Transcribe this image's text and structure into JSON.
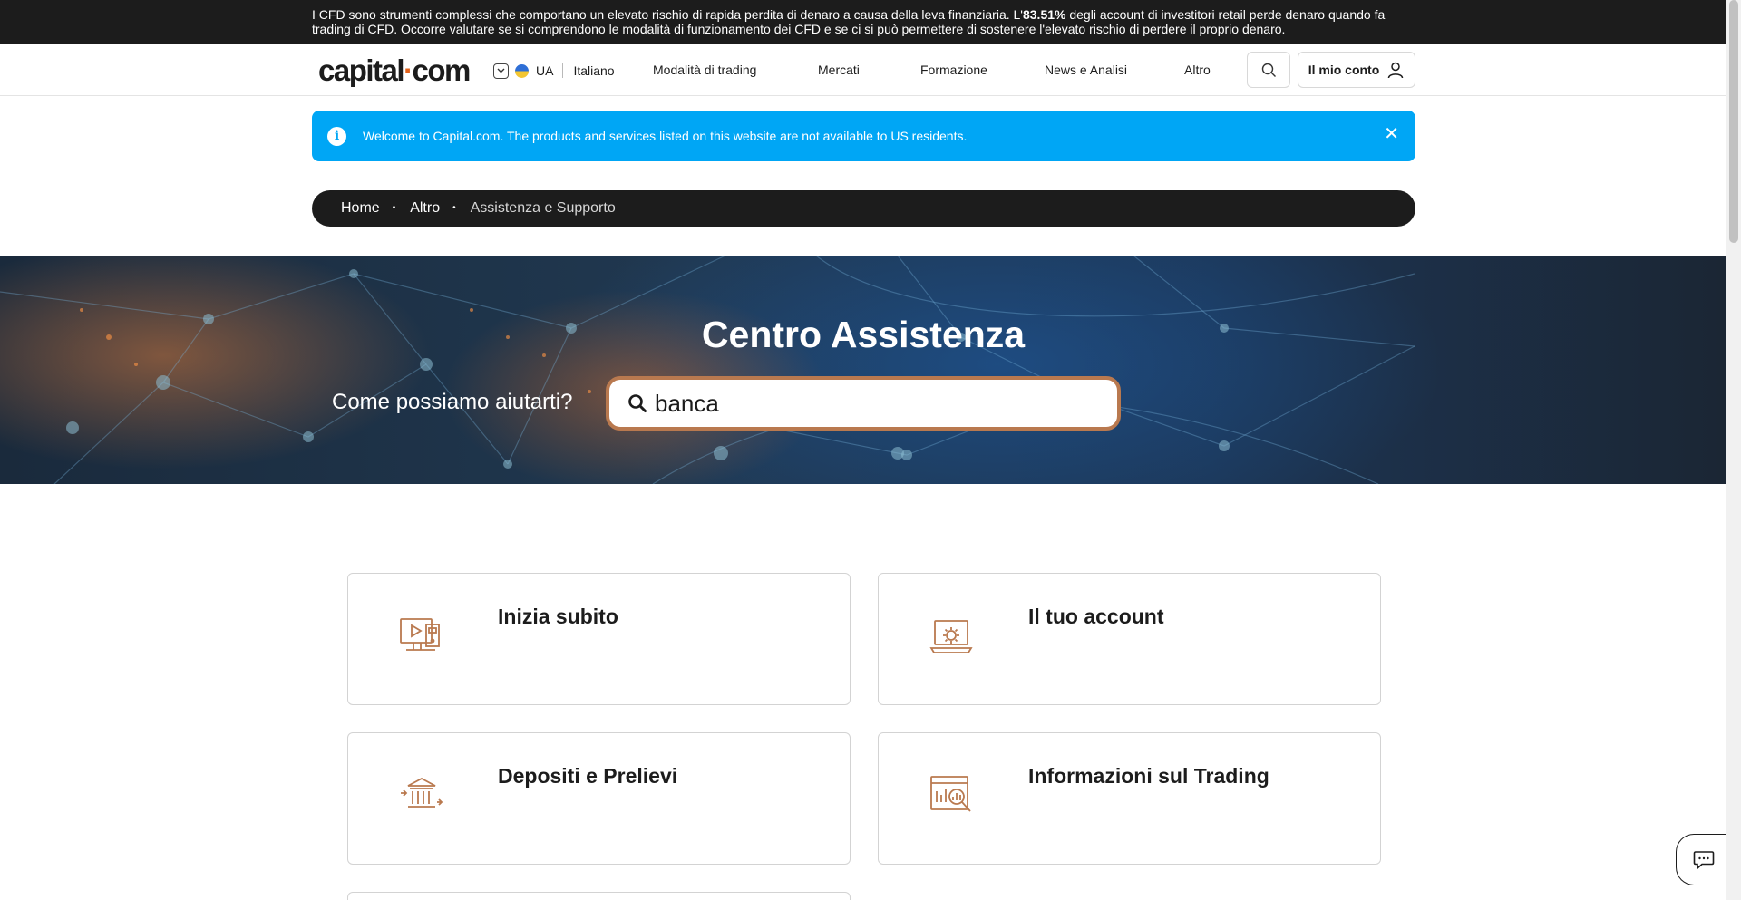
{
  "risk_warning": {
    "text_before": "I CFD sono strumenti complessi che comportano un elevato rischio di rapida perdita di denaro a causa della leva finanziaria. L'",
    "percent": "83.51%",
    "text_after": " degli account di investitori retail perde denaro quando fa trading di CFD. Occorre valutare se si comprendono le modalità di funzionamento dei CFD e se ci si può permettere di sostenere l'elevato rischio di perdere il proprio denaro."
  },
  "header": {
    "logo_left": "capital",
    "logo_dot": "·",
    "logo_right": "com",
    "region_code": "UA",
    "language": "Italiano",
    "nav": [
      "Modalità di trading",
      "Mercati",
      "Formazione",
      "News e Analisi",
      "Altro"
    ],
    "account_label": "Il mio conto"
  },
  "welcome_banner": {
    "message": "Welcome to Capital.com. The products and services listed on this website are not available to US residents.",
    "close_symbol": "✕",
    "info_symbol": "i"
  },
  "breadcrumb": {
    "items": [
      "Home",
      "Altro"
    ],
    "current": "Assistenza e Supporto",
    "separator": "•"
  },
  "hero": {
    "title": "Centro Assistenza",
    "search_label": "Come possiamo aiutarti?",
    "search_value": "banca"
  },
  "cards": [
    {
      "title": "Inizia subito",
      "icon": "video-screen-icon"
    },
    {
      "title": "Il tuo account",
      "icon": "laptop-gear-icon"
    },
    {
      "title": "Depositi e Prelievi",
      "icon": "bank-transfer-icon"
    },
    {
      "title": "Informazioni sul Trading",
      "icon": "chart-analysis-icon"
    }
  ],
  "colors": {
    "accent_orange": "#e2621b",
    "icon_brown": "#b9794f",
    "banner_blue": "#00a6f5",
    "dark": "#1c1c1c"
  }
}
